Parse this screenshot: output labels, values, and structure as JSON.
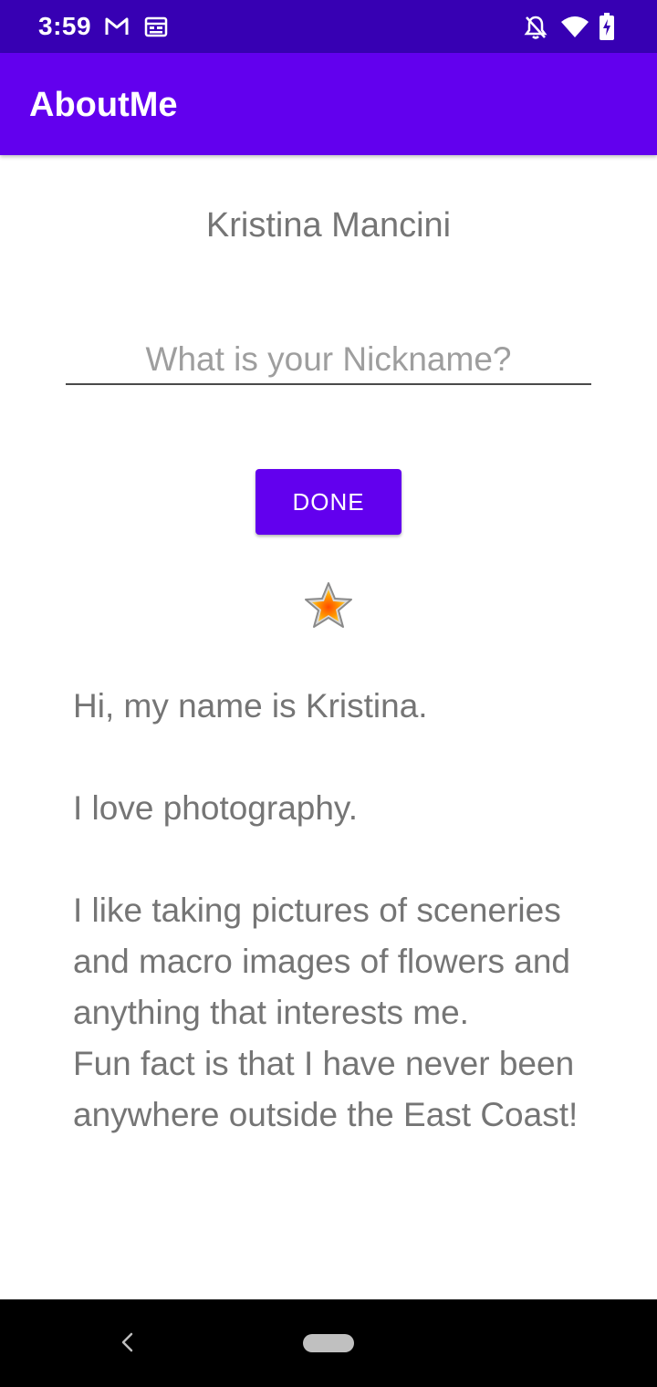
{
  "status_bar": {
    "time": "3:59",
    "icons": [
      "gmail-icon",
      "calendar-icon",
      "notifications-off-icon",
      "wifi-icon",
      "battery-charging-icon"
    ]
  },
  "app_bar": {
    "title": "AboutMe"
  },
  "profile": {
    "name": "Kristina Mancini",
    "nickname_placeholder": "What is your Nickname?",
    "nickname_value": "",
    "done_label": "DONE",
    "star_icon": "star-icon",
    "bio": "Hi, my name is Kristina.\n\nI love photography.\n\nI like taking pictures of sceneries and macro images of flowers and anything that interests me.\nFun fact is that I have never been anywhere outside the East Coast!"
  },
  "navigation": {
    "back_icon": "back-icon",
    "home_icon": "home-pill-icon"
  },
  "colors": {
    "status_bar": "#3700b3",
    "app_bar": "#6200ee",
    "button": "#6200ee",
    "text_secondary": "#757575",
    "nav_bar": "#000000"
  }
}
